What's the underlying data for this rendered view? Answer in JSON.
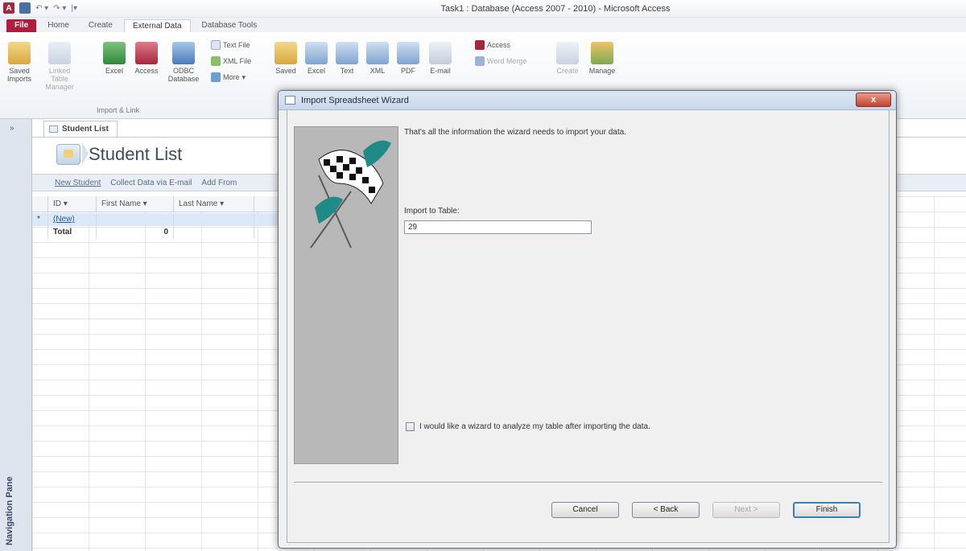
{
  "window": {
    "title": "Task1 : Database (Access 2007 - 2010)  -  Microsoft Access"
  },
  "ribbon": {
    "tabs": [
      "File",
      "Home",
      "Create",
      "External Data",
      "Database Tools"
    ],
    "active_tab": "External Data",
    "import_group": {
      "label": "Import & Link",
      "saved_imports": "Saved Imports",
      "linked_table_manager": "Linked Table Manager",
      "excel": "Excel",
      "access": "Access",
      "odbc": "ODBC Database",
      "text_file": "Text File",
      "xml_file": "XML File",
      "more": "More"
    },
    "export_group": {
      "saved_exports": "Saved",
      "excel": "Excel",
      "text": "Text",
      "xml": "XML",
      "pdf": "PDF",
      "email": "E-mail",
      "access": "Access",
      "word_merge": "Word Merge"
    },
    "collect_group": {
      "create_email": "Create",
      "manage_replies": "Manage"
    }
  },
  "nav_pane": {
    "label": "Navigation Pane",
    "toggle": "»"
  },
  "document": {
    "tab_label": "Student List",
    "title": "Student List",
    "actions": [
      "New Student",
      "Collect Data via E-mail",
      "Add From"
    ],
    "columns": [
      "ID",
      "First Name",
      "Last Name"
    ],
    "new_row_marker": "*",
    "new_row_id": "(New)",
    "total_label": "Total",
    "total_value": "0"
  },
  "dialog": {
    "title": "Import Spreadsheet Wizard",
    "close_label": "x",
    "message": "That's all the information the wizard needs to import your data.",
    "import_to_label": "Import to Table:",
    "import_to_value": "29 ",
    "checkbox_label": "I would like a wizard to analyze my table after importing the data.",
    "checkbox_checked": false,
    "buttons": {
      "cancel": "Cancel",
      "back": "< Back",
      "next": "Next >",
      "finish": "Finish"
    }
  },
  "colors": {
    "file_tab": "#b01c3b",
    "dialog_close": "#c4432e",
    "flag_ribbon": "#1f8a86"
  }
}
